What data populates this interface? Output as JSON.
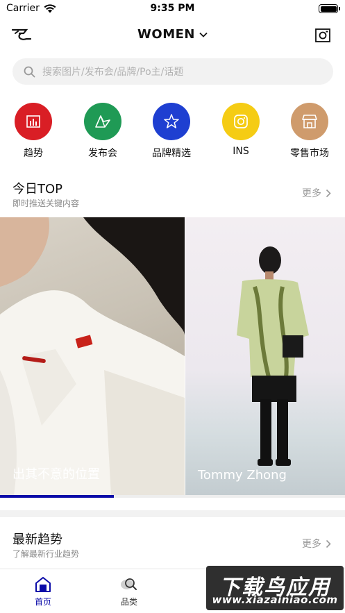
{
  "status_bar": {
    "carrier": "Carrier",
    "time": "9:35 PM"
  },
  "nav": {
    "gender": "WOMEN",
    "logo_icon": "brand-logo-icon",
    "camera_icon": "camera-icon"
  },
  "search": {
    "placeholder": "搜索图片/发布会/品牌/Po主/话题"
  },
  "quick_nav": [
    {
      "label": "趋势",
      "icon": "bar-chart-icon",
      "color": "#d91e25"
    },
    {
      "label": "发布会",
      "icon": "runway-icon",
      "color": "#1f9a55"
    },
    {
      "label": "品牌精选",
      "icon": "star-icon",
      "color": "#1e3fd1"
    },
    {
      "label": "INS",
      "icon": "instagram-icon",
      "color": "#f5cc14"
    },
    {
      "label": "零售市场",
      "icon": "storefront-icon",
      "color": "#cf9b6c"
    }
  ],
  "today_top": {
    "title": "今日TOP",
    "subtitle": "即时推送关键内容",
    "more": "更多",
    "cards": [
      {
        "caption": "出其不意的位置"
      },
      {
        "caption": "Tommy Zhong"
      }
    ],
    "progress": 0.33,
    "accent": "#0a0aa8"
  },
  "latest_trends": {
    "title": "最新趋势",
    "subtitle": "了解最新行业趋势",
    "more": "更多"
  },
  "tab_bar": {
    "items": [
      {
        "label": "首页",
        "icon": "home-icon",
        "active": true
      },
      {
        "label": "品类",
        "icon": "search-category-icon",
        "active": false
      }
    ],
    "active_color": "#0a0aa8"
  },
  "watermark": {
    "line1": "下载鸟应用",
    "line2": "www.xiazainiao.com"
  }
}
